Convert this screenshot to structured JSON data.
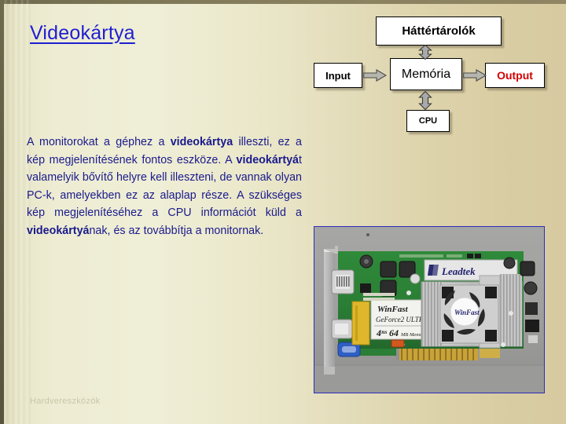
{
  "slide": {
    "title": "Videokártya",
    "footer": "Hardvereszközök",
    "colors": {
      "title": "#1f1fd2",
      "body_text": "#1a1a8c",
      "output_label": "#d40000",
      "background_left": "#efeed6",
      "background_right": "#d7caa0",
      "photo_border": "#2b2bbb",
      "footer_text": "#c9c6a8"
    }
  },
  "body": {
    "segments": [
      {
        "text": "A monitorokat a géphez a ",
        "bold": false
      },
      {
        "text": "videokártya",
        "bold": true
      },
      {
        "text": " illeszti, ez a kép megjelenítésének fontos eszköze. A ",
        "bold": false
      },
      {
        "text": "videokártyá",
        "bold": true
      },
      {
        "text": "t valamelyik bővítő helyre kell illeszteni, de vannak olyan PC-k, amelyekben ez az alaplap része. A szükséges kép megjelenítéséhez a CPU információt küld a ",
        "bold": false
      },
      {
        "text": "videokártyá",
        "bold": true
      },
      {
        "text": "nak, és az továbbítja a monitornak.",
        "bold": false
      }
    ],
    "plain": "A monitorokat a géphez a videokártya illeszti, ez a kép megjelenítésének fontos eszköze. A videokártyát valamelyik bővítő helyre kell illeszteni, de vannak olyan PC-k, amelyekben ez az alaplap része. A szükséges kép megjelenítéséhez a CPU információt küld a videokártyának, és az továbbítja a monitornak."
  },
  "diagram": {
    "name": "computer-architecture-diagram",
    "boxes": {
      "storage": "Háttértárolók",
      "input": "Input",
      "memory": "Memória",
      "output": "Output",
      "cpu": "CPU"
    },
    "arrows": [
      {
        "name": "arrow-storage-memory",
        "direction": "bidirectional",
        "orientation": "vertical",
        "from": "Háttértárolók",
        "to": "Memória"
      },
      {
        "name": "arrow-input-memory",
        "direction": "right",
        "orientation": "horizontal",
        "from": "Input",
        "to": "Memória"
      },
      {
        "name": "arrow-memory-output",
        "direction": "right",
        "orientation": "horizontal",
        "from": "Memória",
        "to": "Output"
      },
      {
        "name": "arrow-memory-cpu",
        "direction": "bidirectional",
        "orientation": "vertical",
        "from": "Memória",
        "to": "CPU"
      }
    ]
  },
  "photo": {
    "name": "videocard-photo",
    "alt": "Leadtek WinFast GeForce2 ULTRA AGP videokártya",
    "labels": {
      "brand": "Leadtek",
      "model_line1": "WinFast",
      "model_line2": "GeForce2 ULTRA",
      "model_line3": "4NS 64 MB Memory",
      "fan_hub": "WinFast"
    }
  }
}
